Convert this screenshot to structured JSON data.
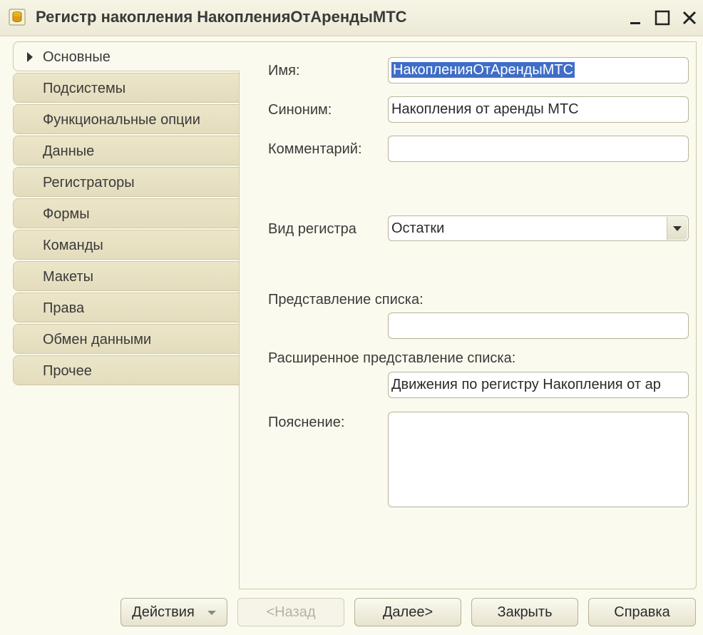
{
  "window": {
    "title": "Регистр накопления НакопленияОтАрендыМТС",
    "icon": "accumulation-register-icon",
    "controls": [
      "minimize-icon",
      "maximize-icon",
      "close-icon"
    ]
  },
  "tabs": [
    {
      "label": "Основные",
      "active": true
    },
    {
      "label": "Подсистемы"
    },
    {
      "label": "Функциональные опции"
    },
    {
      "label": "Данные"
    },
    {
      "label": "Регистраторы"
    },
    {
      "label": "Формы"
    },
    {
      "label": "Команды"
    },
    {
      "label": "Макеты"
    },
    {
      "label": "Права"
    },
    {
      "label": "Обмен данными"
    },
    {
      "label": "Прочее"
    }
  ],
  "form": {
    "name_label": "Имя:",
    "name_value": "НакопленияОтАрендыМТС",
    "synonym_label": "Синоним:",
    "synonym_value": "Накопления от аренды МТС",
    "comment_label": "Комментарий:",
    "comment_value": "",
    "register_kind_label": "Вид регистра",
    "register_kind_value": "Остатки",
    "list_presentation_label": "Представление списка:",
    "list_presentation_value": "",
    "ext_list_presentation_label": "Расширенное представление списка:",
    "ext_list_presentation_value": "Движения по регистру Накопления от ар",
    "explanation_label": "Пояснение:",
    "explanation_value": ""
  },
  "buttons": {
    "actions": "Действия",
    "back": "<Назад",
    "next": "Далее>",
    "close": "Закрыть",
    "help": "Справка"
  },
  "colors": {
    "background": "#fbfaee",
    "tab": "#e6dfc1",
    "selection": "#3f6ec7"
  }
}
